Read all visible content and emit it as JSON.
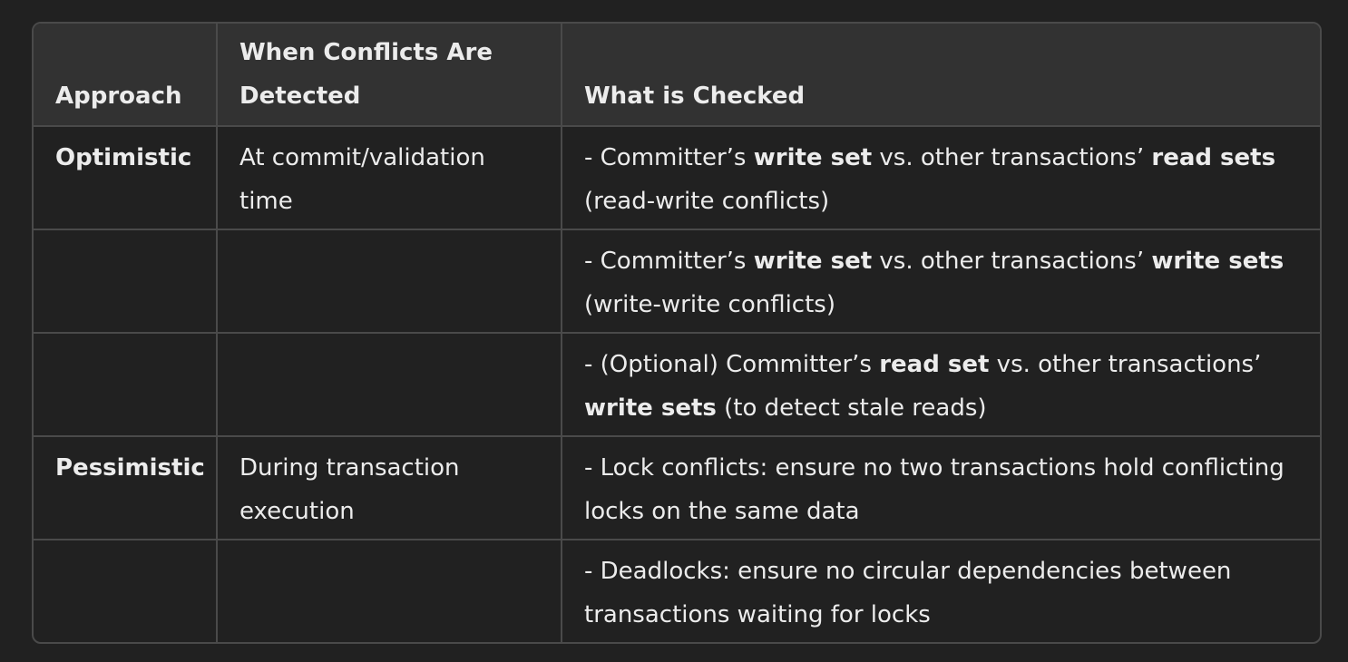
{
  "table": {
    "headers": {
      "approach": "Approach",
      "when": "When Conflicts Are Detected",
      "checked": "What is Checked"
    },
    "rows": [
      {
        "approach": "Optimistic",
        "when": "At commit/validation time",
        "checked": [
          {
            "t": "- Committer’s ",
            "b": false
          },
          {
            "t": "write set",
            "b": true
          },
          {
            "t": " vs. other transactions’ ",
            "b": false
          },
          {
            "t": "read sets",
            "b": true
          },
          {
            "t": " (read-write conflicts)",
            "b": false
          }
        ]
      },
      {
        "approach": "",
        "when": "",
        "checked": [
          {
            "t": "- Committer’s ",
            "b": false
          },
          {
            "t": "write set",
            "b": true
          },
          {
            "t": " vs. other transactions’ ",
            "b": false
          },
          {
            "t": "write sets",
            "b": true
          },
          {
            "t": " (write-write conflicts)",
            "b": false
          }
        ]
      },
      {
        "approach": "",
        "when": "",
        "checked": [
          {
            "t": "- (Optional) Committer’s ",
            "b": false
          },
          {
            "t": "read set",
            "b": true
          },
          {
            "t": " vs. other transactions’ ",
            "b": false
          },
          {
            "t": "write sets",
            "b": true
          },
          {
            "t": " (to detect stale reads)",
            "b": false
          }
        ]
      },
      {
        "approach": "Pessimistic",
        "when": "During transaction execution",
        "checked": [
          {
            "t": "- Lock conflicts: ensure no two transactions hold conflicting locks on the same data",
            "b": false
          }
        ]
      },
      {
        "approach": "",
        "when": "",
        "checked": [
          {
            "t": "- Deadlocks: ensure no circular dependencies between transactions waiting for locks",
            "b": false
          }
        ]
      }
    ]
  }
}
